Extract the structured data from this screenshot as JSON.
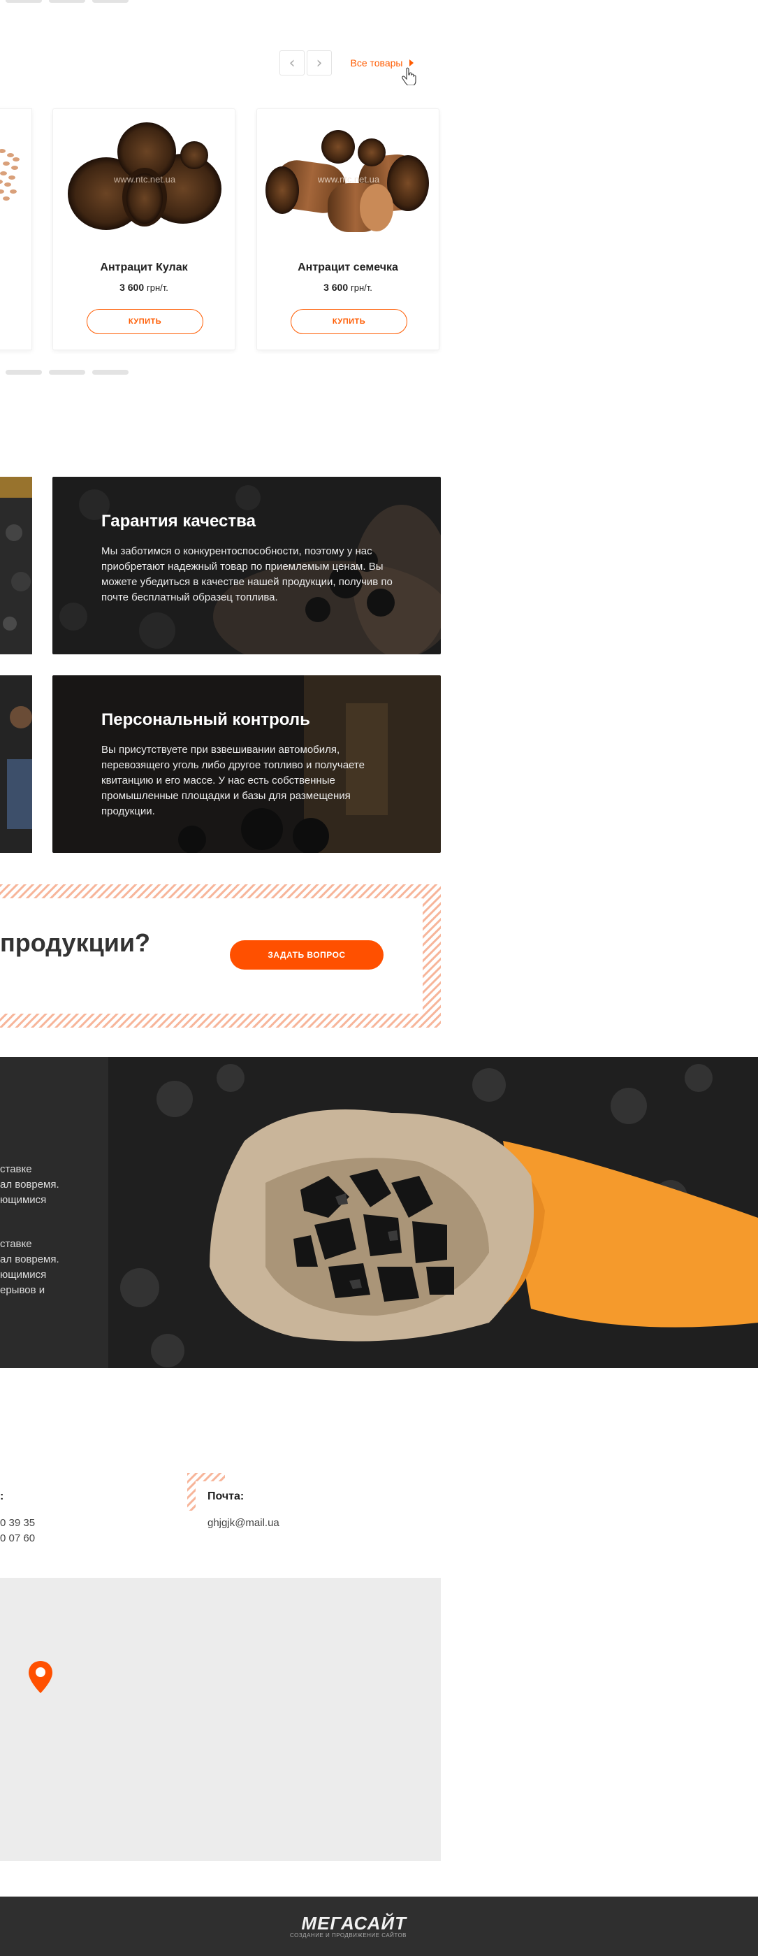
{
  "slider": {
    "prev_icon": "chevron-left-icon",
    "next_icon": "chevron-right-icon",
    "all_goods_label": "Все товары",
    "products": [
      {
        "name": "Антрацит Кулак",
        "price": "3 600",
        "unit": "грн/т.",
        "buy_label": "КУПИТЬ",
        "watermark": "www.ntc.net.ua"
      },
      {
        "name": "Антрацит семечка",
        "price": "3 600",
        "unit": "грн/т.",
        "buy_label": "КУПИТЬ",
        "watermark": "www.ntc.net.ua"
      }
    ]
  },
  "features": [
    {
      "title": "Гарантия качества",
      "text": "Мы заботимся о конкурентоспособности, поэтому у нас приобретают надежный товар по приемлемым ценам. Вы можете убедиться в качестве нашей продукции, получив по почте бесплатный образец топлива."
    },
    {
      "title": "Персональный контроль",
      "text": "Вы присутствуете при взвешивании автомобиля, перевозящего уголь либо другое топливо и получаете квитанцию и его массе. У нас есть собственные промышленные площадки и базы для размещения продукции."
    }
  ],
  "question": {
    "text": "продукции?",
    "button_label": "ЗАДАТЬ ВОПРОС"
  },
  "banner": {
    "text_1": [
      "ставке",
      "ал вовремя.",
      "ющимися"
    ],
    "text_2": [
      "ставке",
      "ал вовремя.",
      "ющимися",
      "ерывов и"
    ]
  },
  "contacts": {
    "phones_label": ":",
    "phones": [
      "0 39 35",
      "0 07 60"
    ],
    "email_label": "Почта:",
    "email": "ghjgjk@mail.ua"
  },
  "footer": {
    "logo": "МЕГАСАЙТ",
    "logo_sub": "СОЗДАНИЕ И ПРОДВИЖЕНИЕ САЙТОВ"
  },
  "colors": {
    "accent": "#ff5b00",
    "footer_bg": "#2f2f2f",
    "map_bg": "#ececec"
  }
}
